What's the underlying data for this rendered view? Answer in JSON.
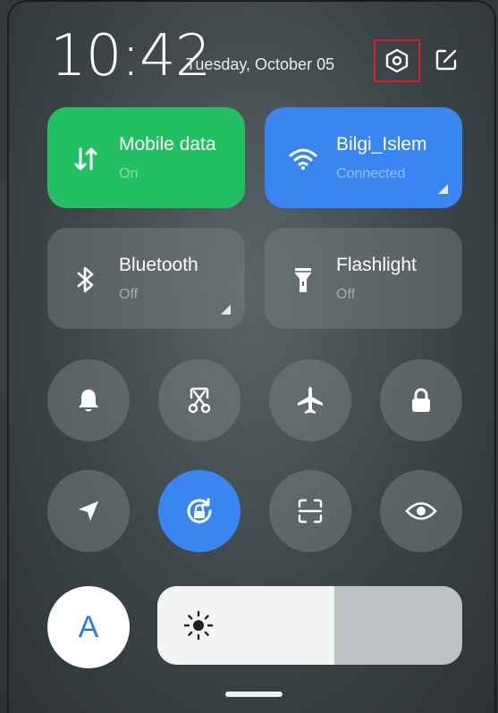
{
  "status": {
    "time": "10:42",
    "date": "Tuesday, October 05"
  },
  "header": {
    "settings_icon": "settings-hexagon-icon",
    "edit_icon": "edit-icon"
  },
  "tiles": [
    {
      "title": "Mobile data",
      "subtitle": "On",
      "icon": "mobile-data-arrows-icon",
      "color": "#22c063",
      "active": true
    },
    {
      "title": "Bilgi_Islem",
      "subtitle": "Connected",
      "icon": "wifi-icon",
      "color": "#3a86f0",
      "active": true
    },
    {
      "title": "Bluetooth",
      "subtitle": "Off",
      "icon": "bluetooth-icon",
      "active": false
    },
    {
      "title": "Flashlight",
      "subtitle": "Off",
      "icon": "flashlight-icon",
      "active": false
    }
  ],
  "toggles_row1": [
    {
      "icon": "bell-icon",
      "active": false
    },
    {
      "icon": "screenshot-scissors-icon",
      "active": false
    },
    {
      "icon": "airplane-icon",
      "active": false
    },
    {
      "icon": "lock-icon",
      "active": false
    }
  ],
  "toggles_row2": [
    {
      "icon": "location-arrow-icon",
      "active": false
    },
    {
      "icon": "rotation-lock-icon",
      "active": true
    },
    {
      "icon": "scan-icon",
      "active": false
    },
    {
      "icon": "eye-icon",
      "active": false
    }
  ],
  "brightness": {
    "auto_label": "A",
    "level": 0.58,
    "icon": "sun-icon"
  },
  "colors": {
    "accent_blue": "#3a86f0",
    "accent_green": "#22c063",
    "highlight_red": "#d0242c"
  }
}
